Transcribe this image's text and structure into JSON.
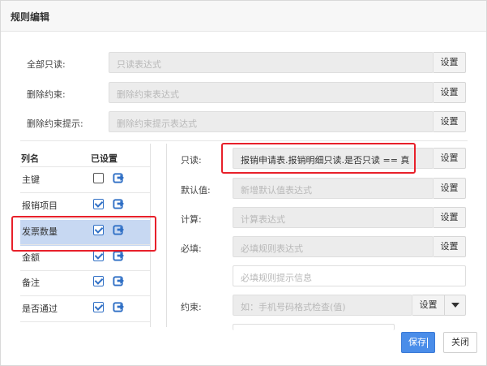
{
  "dialog": {
    "title": "规则编辑"
  },
  "top_rules": [
    {
      "label": "全部只读:",
      "placeholder": "只读表达式",
      "button": "设置"
    },
    {
      "label": "删除约束:",
      "placeholder": "删除约束表达式",
      "button": "设置"
    },
    {
      "label": "删除约束提示:",
      "placeholder": "删除约束提示表达式",
      "button": "设置"
    }
  ],
  "column_list": {
    "header_name": "列名",
    "header_set": "已设置",
    "rows": [
      {
        "name": "主键",
        "checked": false
      },
      {
        "name": "报销项目",
        "checked": true
      },
      {
        "name": "发票数量",
        "checked": true,
        "selected": true
      },
      {
        "name": "金额",
        "checked": true
      },
      {
        "name": "备注",
        "checked": true
      },
      {
        "name": "是否通过",
        "checked": true
      }
    ]
  },
  "column_rules": {
    "readonly": {
      "label": "只读:",
      "value": "报销申请表.报销明细只读.是否只读 == 真",
      "button": "设置"
    },
    "default": {
      "label": "默认值:",
      "placeholder": "新增默认值表达式",
      "button": "设置"
    },
    "compute": {
      "label": "计算:",
      "placeholder": "计算表达式",
      "button": "设置"
    },
    "required": {
      "label": "必填:",
      "placeholder": "必填规则表达式",
      "button": "设置"
    },
    "required_hint": {
      "placeholder": "必填规则提示信息"
    },
    "constraint": {
      "label": "约束:",
      "placeholder": "如：手机号码格式检查(值)",
      "button": "设置"
    }
  },
  "footer": {
    "save": "保存",
    "close": "关闭"
  },
  "colors": {
    "accent": "#4a8de9",
    "highlight": "#e8202a",
    "selected_row": "#c7d8f2",
    "checkbox": "#2f6fc5"
  }
}
